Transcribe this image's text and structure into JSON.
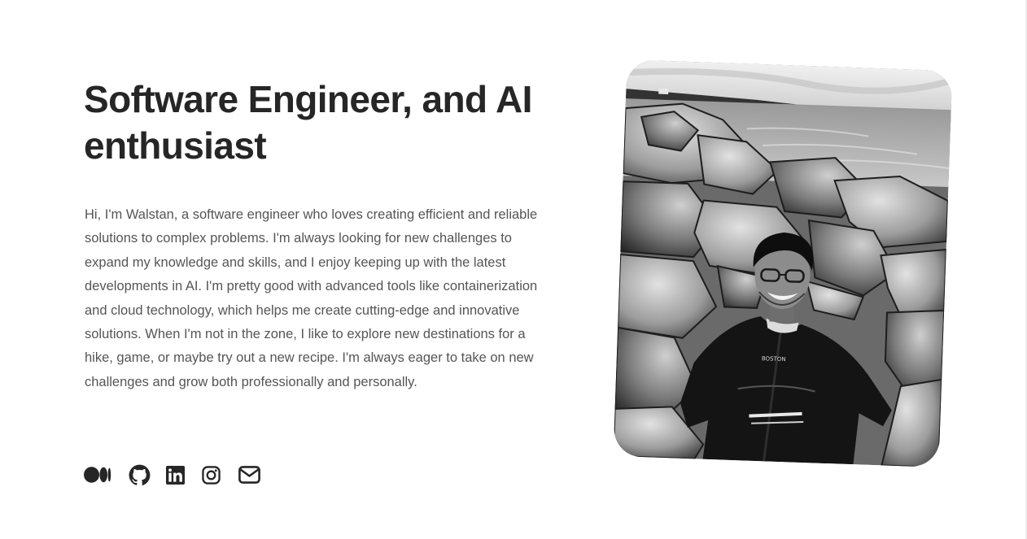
{
  "hero": {
    "title": "Software Engineer, and AI enthusiast",
    "bio": "Hi, I'm Walstan, a software engineer who loves creating efficient and reliable solutions to complex problems. I'm always looking for new challenges to expand my knowledge and skills, and I enjoy keeping up with the latest developments in AI. I'm pretty good with advanced tools like containerization and cloud technology, which helps me create cutting-edge and innovative solutions. When I'm not in the zone, I like to explore new destinations for a hike, game, or maybe try out a new recipe. I'm always eager to take on new challenges and grow both professionally and personally."
  },
  "social": [
    {
      "icon": "medium-icon"
    },
    {
      "icon": "github-icon"
    },
    {
      "icon": "linkedin-icon"
    },
    {
      "icon": "instagram-icon"
    },
    {
      "icon": "mail-icon"
    }
  ],
  "photo": {
    "shirt_text": "BOSTON"
  },
  "colors": {
    "text": "#262626",
    "body_text": "#555555",
    "background": "#ffffff"
  }
}
